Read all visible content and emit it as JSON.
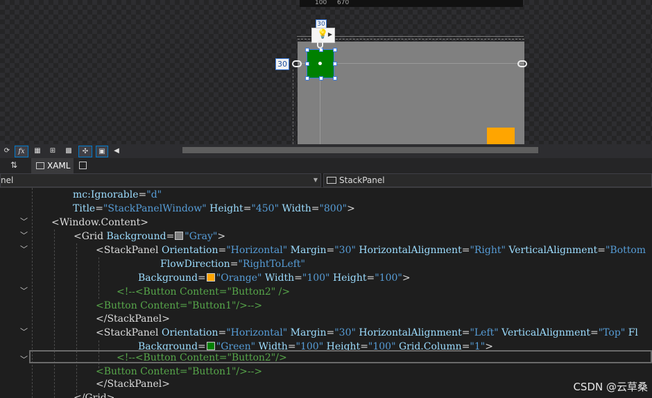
{
  "designer": {
    "ruler_values": [
      "100",
      "670"
    ],
    "margin_left_value": "30",
    "margin_top_value": "30",
    "colors": {
      "grid": "#808080",
      "green_panel": "#008000",
      "orange_panel": "#FFA500",
      "selection": "#3b7ce0"
    }
  },
  "toolbar": {
    "icons": [
      "refresh-icon",
      "fx-icon",
      "grid-icon",
      "snap-grid-icon",
      "checkerboard-icon",
      "snap-lines-icon",
      "xaml-icon",
      "scroll-left-icon"
    ]
  },
  "tabs": {
    "swap_label": "⇅",
    "xaml_label": "XAML"
  },
  "navbar": {
    "left_label": "nel",
    "right_label": "StackPanel"
  },
  "code": {
    "l1_attr": "mc:Ignorable",
    "l1_val": "\"d\"",
    "l2_title_attr": "Title",
    "l2_title_val": "\"StackPanelWindow\"",
    "l2_height_attr": "Height",
    "l2_height_val": "\"450\"",
    "l2_width_attr": "Width",
    "l2_width_val": "\"800\"",
    "l2_close": ">",
    "l3_open": "<",
    "l3_el": "Window.Content",
    "l3_close": ">",
    "l4_el": "Grid",
    "l4_attr": "Background",
    "l4_val": "\"Gray\"",
    "l4_close": ">",
    "l5_el": "StackPanel",
    "l5_a1": "Orientation",
    "l5_v1": "\"Horizontal\"",
    "l5_a2": "Margin",
    "l5_v2": "\"30\"",
    "l5_a3": "HorizontalAlignment",
    "l5_v3": "\"Right\"",
    "l5_a4": "VerticalAlignment",
    "l5_v4": "\"Bottom",
    "l6_attr": "FlowDirection",
    "l6_val": "\"RightToLeft\"",
    "l7_a1": "Background",
    "l7_v1": "\"Orange\"",
    "l7_a2": "Width",
    "l7_v2": "\"100\"",
    "l7_a3": "Height",
    "l7_v3": "\"100\"",
    "l7_close": ">",
    "l8_comment": "<!--<Button Content=\"Button2\" />",
    "l9_comment": "<Button Content=\"Button1\"/>-->",
    "l10_close": "</StackPanel>",
    "l11_el": "StackPanel",
    "l11_a1": "Orientation",
    "l11_v1": "\"Horizontal\"",
    "l11_a2": "Margin",
    "l11_v2": "\"30\"",
    "l11_a3": "HorizontalAlignment",
    "l11_v3": "\"Left\"",
    "l11_a4": "VerticalAlignment",
    "l11_v4": "\"Top\"",
    "l11_tail": "Fl",
    "l12_a1": "Background",
    "l12_v1": "\"Green\"",
    "l12_a2": "Width",
    "l12_v2": "\"100\"",
    "l12_a3": "Height",
    "l12_v3": "\"100\"",
    "l12_a4": "Grid.Column",
    "l12_v4": "\"1\"",
    "l12_close": ">",
    "l13_comment": "<!--<Button Content=\"Button2\"/>",
    "l14_comment": "<Button Content=\"Button1\"/>-->",
    "l15_close": "</StackPanel>",
    "l16_close": "</Grid>"
  },
  "watermark": "CSDN @云草桑"
}
